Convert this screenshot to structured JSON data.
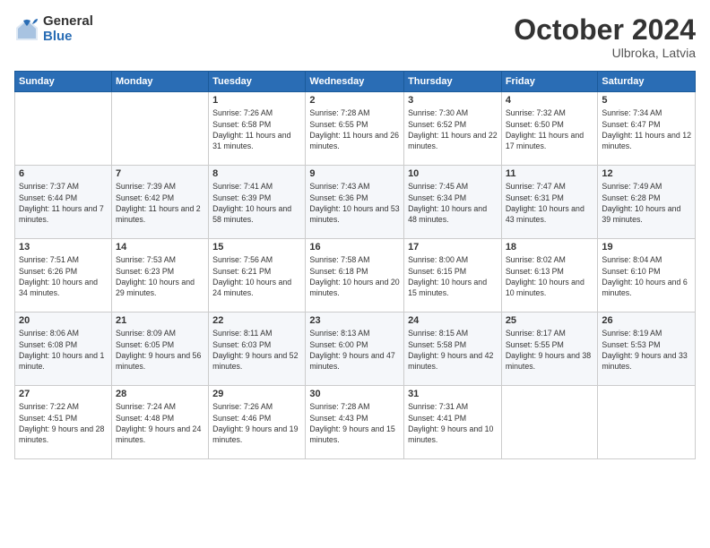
{
  "logo": {
    "general": "General",
    "blue": "Blue"
  },
  "header": {
    "month": "October 2024",
    "location": "Ulbroka, Latvia"
  },
  "days_of_week": [
    "Sunday",
    "Monday",
    "Tuesday",
    "Wednesday",
    "Thursday",
    "Friday",
    "Saturday"
  ],
  "weeks": [
    [
      {
        "day": "",
        "info": ""
      },
      {
        "day": "",
        "info": ""
      },
      {
        "day": "1",
        "info": "Sunrise: 7:26 AM\nSunset: 6:58 PM\nDaylight: 11 hours and 31 minutes."
      },
      {
        "day": "2",
        "info": "Sunrise: 7:28 AM\nSunset: 6:55 PM\nDaylight: 11 hours and 26 minutes."
      },
      {
        "day": "3",
        "info": "Sunrise: 7:30 AM\nSunset: 6:52 PM\nDaylight: 11 hours and 22 minutes."
      },
      {
        "day": "4",
        "info": "Sunrise: 7:32 AM\nSunset: 6:50 PM\nDaylight: 11 hours and 17 minutes."
      },
      {
        "day": "5",
        "info": "Sunrise: 7:34 AM\nSunset: 6:47 PM\nDaylight: 11 hours and 12 minutes."
      }
    ],
    [
      {
        "day": "6",
        "info": "Sunrise: 7:37 AM\nSunset: 6:44 PM\nDaylight: 11 hours and 7 minutes."
      },
      {
        "day": "7",
        "info": "Sunrise: 7:39 AM\nSunset: 6:42 PM\nDaylight: 11 hours and 2 minutes."
      },
      {
        "day": "8",
        "info": "Sunrise: 7:41 AM\nSunset: 6:39 PM\nDaylight: 10 hours and 58 minutes."
      },
      {
        "day": "9",
        "info": "Sunrise: 7:43 AM\nSunset: 6:36 PM\nDaylight: 10 hours and 53 minutes."
      },
      {
        "day": "10",
        "info": "Sunrise: 7:45 AM\nSunset: 6:34 PM\nDaylight: 10 hours and 48 minutes."
      },
      {
        "day": "11",
        "info": "Sunrise: 7:47 AM\nSunset: 6:31 PM\nDaylight: 10 hours and 43 minutes."
      },
      {
        "day": "12",
        "info": "Sunrise: 7:49 AM\nSunset: 6:28 PM\nDaylight: 10 hours and 39 minutes."
      }
    ],
    [
      {
        "day": "13",
        "info": "Sunrise: 7:51 AM\nSunset: 6:26 PM\nDaylight: 10 hours and 34 minutes."
      },
      {
        "day": "14",
        "info": "Sunrise: 7:53 AM\nSunset: 6:23 PM\nDaylight: 10 hours and 29 minutes."
      },
      {
        "day": "15",
        "info": "Sunrise: 7:56 AM\nSunset: 6:21 PM\nDaylight: 10 hours and 24 minutes."
      },
      {
        "day": "16",
        "info": "Sunrise: 7:58 AM\nSunset: 6:18 PM\nDaylight: 10 hours and 20 minutes."
      },
      {
        "day": "17",
        "info": "Sunrise: 8:00 AM\nSunset: 6:15 PM\nDaylight: 10 hours and 15 minutes."
      },
      {
        "day": "18",
        "info": "Sunrise: 8:02 AM\nSunset: 6:13 PM\nDaylight: 10 hours and 10 minutes."
      },
      {
        "day": "19",
        "info": "Sunrise: 8:04 AM\nSunset: 6:10 PM\nDaylight: 10 hours and 6 minutes."
      }
    ],
    [
      {
        "day": "20",
        "info": "Sunrise: 8:06 AM\nSunset: 6:08 PM\nDaylight: 10 hours and 1 minute."
      },
      {
        "day": "21",
        "info": "Sunrise: 8:09 AM\nSunset: 6:05 PM\nDaylight: 9 hours and 56 minutes."
      },
      {
        "day": "22",
        "info": "Sunrise: 8:11 AM\nSunset: 6:03 PM\nDaylight: 9 hours and 52 minutes."
      },
      {
        "day": "23",
        "info": "Sunrise: 8:13 AM\nSunset: 6:00 PM\nDaylight: 9 hours and 47 minutes."
      },
      {
        "day": "24",
        "info": "Sunrise: 8:15 AM\nSunset: 5:58 PM\nDaylight: 9 hours and 42 minutes."
      },
      {
        "day": "25",
        "info": "Sunrise: 8:17 AM\nSunset: 5:55 PM\nDaylight: 9 hours and 38 minutes."
      },
      {
        "day": "26",
        "info": "Sunrise: 8:19 AM\nSunset: 5:53 PM\nDaylight: 9 hours and 33 minutes."
      }
    ],
    [
      {
        "day": "27",
        "info": "Sunrise: 7:22 AM\nSunset: 4:51 PM\nDaylight: 9 hours and 28 minutes."
      },
      {
        "day": "28",
        "info": "Sunrise: 7:24 AM\nSunset: 4:48 PM\nDaylight: 9 hours and 24 minutes."
      },
      {
        "day": "29",
        "info": "Sunrise: 7:26 AM\nSunset: 4:46 PM\nDaylight: 9 hours and 19 minutes."
      },
      {
        "day": "30",
        "info": "Sunrise: 7:28 AM\nSunset: 4:43 PM\nDaylight: 9 hours and 15 minutes."
      },
      {
        "day": "31",
        "info": "Sunrise: 7:31 AM\nSunset: 4:41 PM\nDaylight: 9 hours and 10 minutes."
      },
      {
        "day": "",
        "info": ""
      },
      {
        "day": "",
        "info": ""
      }
    ]
  ]
}
